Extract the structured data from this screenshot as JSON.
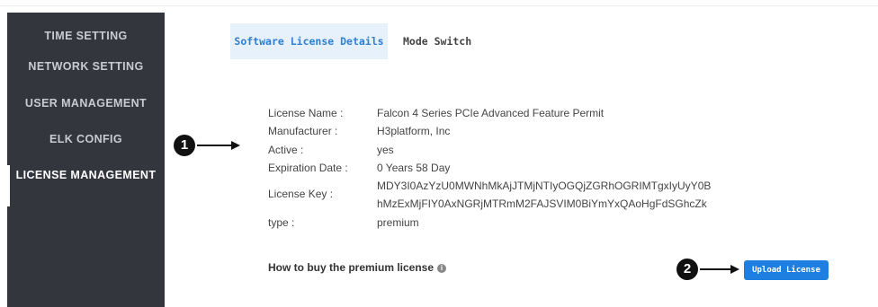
{
  "sidebar": {
    "items": [
      {
        "label": "TIME SETTING"
      },
      {
        "label": "NETWORK SETTING"
      },
      {
        "label": "USER MANAGEMENT"
      },
      {
        "label": "ELK CONFIG"
      },
      {
        "label": "LICENSE MANAGEMENT"
      }
    ],
    "active_index": 4
  },
  "tabs": [
    {
      "label": "Software License Details"
    },
    {
      "label": "Mode Switch"
    }
  ],
  "license": {
    "rows": [
      {
        "label": "License Name :",
        "value": "Falcon 4 Series PCIe Advanced Feature Permit"
      },
      {
        "label": "Manufacturer :",
        "value": "H3platform, Inc"
      },
      {
        "label": "Active :",
        "value": "yes"
      },
      {
        "label": "Expiration Date :",
        "value": "0 Years 58 Day"
      },
      {
        "label": "License Key :",
        "value_lines": [
          "MDY3I0AzYzU0MWNhMkAjJTMjNTIyOGQjZGRhOGRIMTgxIyUyY0B",
          "hMzExMjFIY0AxNGRjMTRmM2FAJSVIM0BiYmYxQAoHgFdSGhcZk"
        ]
      },
      {
        "label": "type :",
        "value": "premium"
      }
    ]
  },
  "help": {
    "text": "How to buy the premium license",
    "icon": "info-icon"
  },
  "actions": {
    "upload_label": "Upload License"
  },
  "callouts": [
    {
      "number": "1"
    },
    {
      "number": "2"
    }
  ],
  "colors": {
    "sidebar_bg": "#33363d",
    "accent": "#1e7fe0",
    "tab_active_bg": "#e7f1fb"
  }
}
